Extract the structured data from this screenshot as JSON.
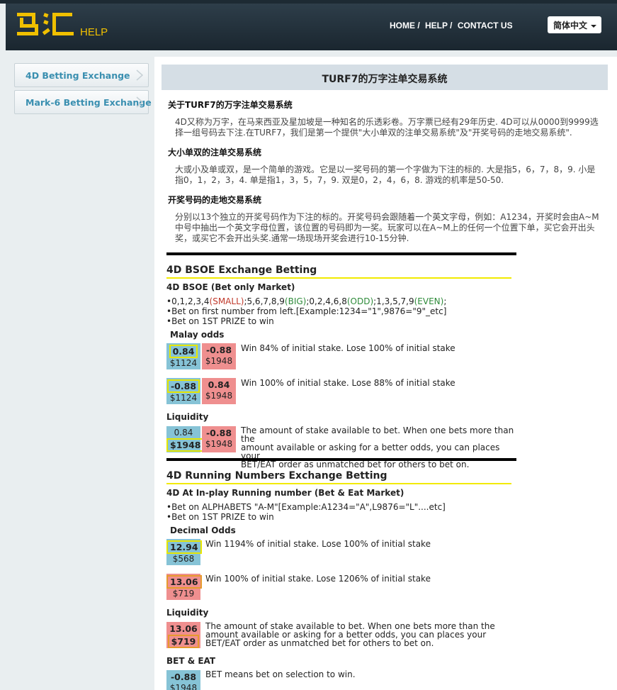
{
  "header": {
    "logo_text": "马汇",
    "logo_sub": "HELP",
    "nav": [
      "HOME",
      "HELP",
      "CONTACT US"
    ],
    "lang": "简体中文"
  },
  "sidebar": {
    "items": [
      {
        "label": "4D Betting Exchange"
      },
      {
        "label": "Mark-6 Betting Exchange"
      }
    ]
  },
  "main": {
    "title": "TURF7的万字注单交易系统",
    "intro": [
      {
        "heading": "关于TURF7的万字注单交易系统",
        "text": "4D又称为万字，在马来西亚及星加坡是一种知名的乐透彩卷。万字票已经有29年历史. 4D可以从0000到9999选择一组号码去下注.在TURF7，我们是第一个提供\"大小单双的注单交易系统\"及\"开奖号码的走地交易系统\"."
      },
      {
        "heading": "大小单双的注单交易系统",
        "text": "大或小及单或双，是一个简单的游戏。它是以一奖号码的第一个字做为下注的标的. 大是指5，6，7，8，9. 小是指0，1，2，3，4. 单是指1，3，5，7，9. 双是0，2，4，6，8. 游戏的机率是50-50."
      },
      {
        "heading": "开奖号码的走地交易系统",
        "text": "分别以13个独立的开奖号码作为下注的标的。开奖号码会跟随着一个英文字母，例如：A1234，开奖时会由A~M中号中抽出一个英文字母位置，该位置的号码即为一奖。玩家可以在A~M上的任何一个位置下单，买它会开出头奖，或买它不会开出头奖.通常一场现场开奖会进行10-15分钟."
      }
    ],
    "bsoe": {
      "title": "4D BSOE Exchange Betting",
      "sub": "4D BSOE (Bet only Market)",
      "line1": {
        "a": "•0,1,2,3,4",
        "small": "(SMALL)",
        "b": ";5,6,7,8,9",
        "big": "(BIG)",
        "c": ";0,2,4,6,8",
        "odd": "(ODD)",
        "d": ";1,3,5,7,9",
        "even": "(EVEN)",
        "e": ";"
      },
      "line2": "•Bet on first number from left.[Example:1234=\"1\",9876=\"9\"_etc]",
      "line3": "•Bet on 1ST PRIZE to win",
      "odds_label": "Malay odds",
      "row1": {
        "back": "0.84",
        "back_amt": "$1124",
        "lay": "-0.88",
        "lay_amt": "$1948",
        "note": "Win 84% of initial stake. Lose 100% of initial stake"
      },
      "row2": {
        "back": "-0.88",
        "back_amt": "$1124",
        "lay": "0.84",
        "lay_amt": "$1948",
        "note": "Win 100% of initial stake. Lose 88% of initial stake"
      },
      "liq_label": "Liquidity",
      "liq": {
        "back": "0.84",
        "back_amt": "$1948",
        "lay": "-0.88",
        "lay_amt": "$1948",
        "note1": "The amount of stake available to bet. When one bets more than the",
        "note2": "amount available or asking for a better odds, you can places your",
        "note3": "BET/EAT order as unmatched bet for others to bet on."
      }
    },
    "running": {
      "title": "4D Running Numbers Exchange Betting",
      "sub": "4D At In-play Running number (Bet & Eat Market)",
      "line1": "•Bet on ALPHABETS \"A-M\"[Example:A1234=\"A\",L9876=\"L\"....etc]",
      "line2": "•Bet on 1ST PRIZE to win",
      "odds_label": "Decimal Odds",
      "row1": {
        "val": "12.94",
        "amt": "$568",
        "note": "Win 1194% of initial stake. Lose 100% of initial stake"
      },
      "row2": {
        "val": "13.06",
        "amt": "$719",
        "note": "Win 100% of initial stake. Lose 1206% of initial stake"
      },
      "liq_label": "Liquidity",
      "liq": {
        "val": "13.06",
        "amt": "$719",
        "note1": "The amount of stake available to bet. When one bets more than the",
        "note2": "amount available or asking for a better odds, you can places your",
        "note3": "BET/EAT order as unmatched bet for others to bet on."
      },
      "be_label": "BET & EAT",
      "be": {
        "val": "-0.88",
        "amt": "$1948",
        "note": "BET means bet on selection to win."
      }
    }
  },
  "colors": {
    "accent": "#3a8fb0",
    "blue_cell": "#86c3d6",
    "pink_cell": "#ef8f8f",
    "logo": "#f0c000"
  }
}
